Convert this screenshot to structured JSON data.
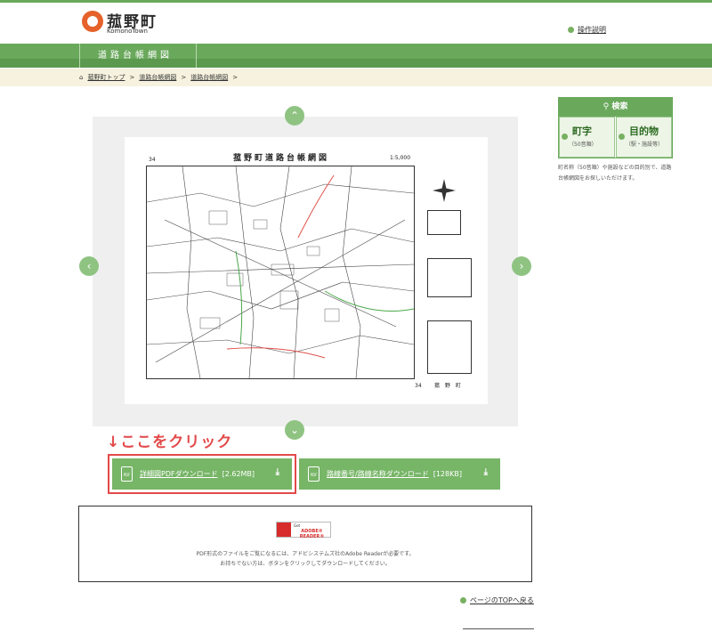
{
  "header": {
    "logo_jp": "菰野町",
    "logo_en": "KomonoTown",
    "help_link": "操作説明"
  },
  "nav": {
    "title": "道路台帳網図"
  },
  "breadcrumb": {
    "items": [
      "菰野町トップ",
      "道路台帳網図",
      "道路台帳網図"
    ],
    "separator": ">"
  },
  "map": {
    "title": "菰野町道路台帳網図",
    "scale": "1:5,000",
    "sheet_number": "34",
    "caption": "菰 野 町"
  },
  "annotation": "↓ここをクリック",
  "downloads": [
    {
      "label": "詳細図PDFダウンロード",
      "size": "[2.62MB]"
    },
    {
      "label": "路線番号/路線名称ダウンロード",
      "size": "[128KB]"
    }
  ],
  "reader": {
    "badge_small": "Get",
    "badge_main": "ADOBE® READER®",
    "line1": "PDF形式のファイルをご覧になるには、アドビシステムズ社のAdobe Readerが必要です。",
    "line2": "お持ちでない方は、ボタンをクリックしてダウンロードしてください。"
  },
  "page_top": "ページのTOPへ戻る",
  "search_panel": {
    "title": "検索",
    "tab1_main": "町字",
    "tab1_sub": "（50音順）",
    "tab2_main": "目的物",
    "tab2_sub": "（駅・施設等）",
    "description": "町名称（50音順）や施設などの目的別で、道路台帳網図をお探しいただけます。"
  },
  "colors": {
    "primary_green": "#6aa95c",
    "button_green": "#77b567",
    "accent_red": "#e34a4a",
    "breadcrumb_bg": "#f6f2df"
  }
}
